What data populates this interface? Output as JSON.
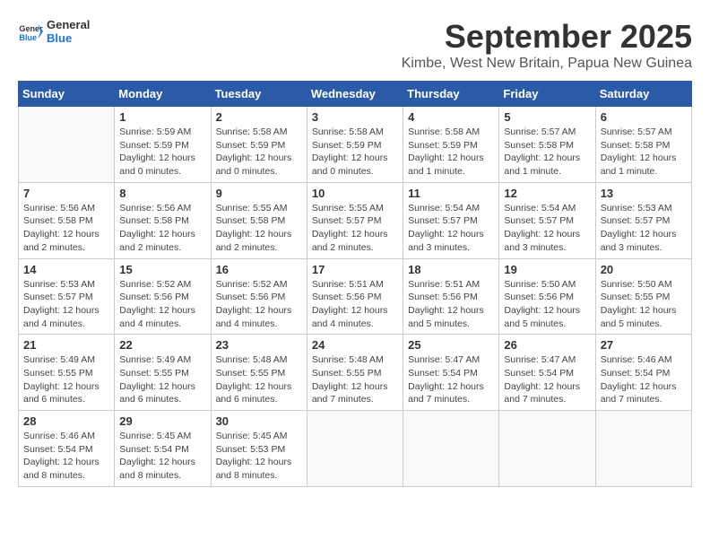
{
  "logo": {
    "general": "General",
    "blue": "Blue"
  },
  "title": "September 2025",
  "subtitle": "Kimbe, West New Britain, Papua New Guinea",
  "headers": [
    "Sunday",
    "Monday",
    "Tuesday",
    "Wednesday",
    "Thursday",
    "Friday",
    "Saturday"
  ],
  "weeks": [
    [
      {
        "day": "",
        "info": ""
      },
      {
        "day": "1",
        "info": "Sunrise: 5:59 AM\nSunset: 5:59 PM\nDaylight: 12 hours\nand 0 minutes."
      },
      {
        "day": "2",
        "info": "Sunrise: 5:58 AM\nSunset: 5:59 PM\nDaylight: 12 hours\nand 0 minutes."
      },
      {
        "day": "3",
        "info": "Sunrise: 5:58 AM\nSunset: 5:59 PM\nDaylight: 12 hours\nand 0 minutes."
      },
      {
        "day": "4",
        "info": "Sunrise: 5:58 AM\nSunset: 5:59 PM\nDaylight: 12 hours\nand 1 minute."
      },
      {
        "day": "5",
        "info": "Sunrise: 5:57 AM\nSunset: 5:58 PM\nDaylight: 12 hours\nand 1 minute."
      },
      {
        "day": "6",
        "info": "Sunrise: 5:57 AM\nSunset: 5:58 PM\nDaylight: 12 hours\nand 1 minute."
      }
    ],
    [
      {
        "day": "7",
        "info": "Sunrise: 5:56 AM\nSunset: 5:58 PM\nDaylight: 12 hours\nand 2 minutes."
      },
      {
        "day": "8",
        "info": "Sunrise: 5:56 AM\nSunset: 5:58 PM\nDaylight: 12 hours\nand 2 minutes."
      },
      {
        "day": "9",
        "info": "Sunrise: 5:55 AM\nSunset: 5:58 PM\nDaylight: 12 hours\nand 2 minutes."
      },
      {
        "day": "10",
        "info": "Sunrise: 5:55 AM\nSunset: 5:57 PM\nDaylight: 12 hours\nand 2 minutes."
      },
      {
        "day": "11",
        "info": "Sunrise: 5:54 AM\nSunset: 5:57 PM\nDaylight: 12 hours\nand 3 minutes."
      },
      {
        "day": "12",
        "info": "Sunrise: 5:54 AM\nSunset: 5:57 PM\nDaylight: 12 hours\nand 3 minutes."
      },
      {
        "day": "13",
        "info": "Sunrise: 5:53 AM\nSunset: 5:57 PM\nDaylight: 12 hours\nand 3 minutes."
      }
    ],
    [
      {
        "day": "14",
        "info": "Sunrise: 5:53 AM\nSunset: 5:57 PM\nDaylight: 12 hours\nand 4 minutes."
      },
      {
        "day": "15",
        "info": "Sunrise: 5:52 AM\nSunset: 5:56 PM\nDaylight: 12 hours\nand 4 minutes."
      },
      {
        "day": "16",
        "info": "Sunrise: 5:52 AM\nSunset: 5:56 PM\nDaylight: 12 hours\nand 4 minutes."
      },
      {
        "day": "17",
        "info": "Sunrise: 5:51 AM\nSunset: 5:56 PM\nDaylight: 12 hours\nand 4 minutes."
      },
      {
        "day": "18",
        "info": "Sunrise: 5:51 AM\nSunset: 5:56 PM\nDaylight: 12 hours\nand 5 minutes."
      },
      {
        "day": "19",
        "info": "Sunrise: 5:50 AM\nSunset: 5:56 PM\nDaylight: 12 hours\nand 5 minutes."
      },
      {
        "day": "20",
        "info": "Sunrise: 5:50 AM\nSunset: 5:55 PM\nDaylight: 12 hours\nand 5 minutes."
      }
    ],
    [
      {
        "day": "21",
        "info": "Sunrise: 5:49 AM\nSunset: 5:55 PM\nDaylight: 12 hours\nand 6 minutes."
      },
      {
        "day": "22",
        "info": "Sunrise: 5:49 AM\nSunset: 5:55 PM\nDaylight: 12 hours\nand 6 minutes."
      },
      {
        "day": "23",
        "info": "Sunrise: 5:48 AM\nSunset: 5:55 PM\nDaylight: 12 hours\nand 6 minutes."
      },
      {
        "day": "24",
        "info": "Sunrise: 5:48 AM\nSunset: 5:55 PM\nDaylight: 12 hours\nand 7 minutes."
      },
      {
        "day": "25",
        "info": "Sunrise: 5:47 AM\nSunset: 5:54 PM\nDaylight: 12 hours\nand 7 minutes."
      },
      {
        "day": "26",
        "info": "Sunrise: 5:47 AM\nSunset: 5:54 PM\nDaylight: 12 hours\nand 7 minutes."
      },
      {
        "day": "27",
        "info": "Sunrise: 5:46 AM\nSunset: 5:54 PM\nDaylight: 12 hours\nand 7 minutes."
      }
    ],
    [
      {
        "day": "28",
        "info": "Sunrise: 5:46 AM\nSunset: 5:54 PM\nDaylight: 12 hours\nand 8 minutes."
      },
      {
        "day": "29",
        "info": "Sunrise: 5:45 AM\nSunset: 5:54 PM\nDaylight: 12 hours\nand 8 minutes."
      },
      {
        "day": "30",
        "info": "Sunrise: 5:45 AM\nSunset: 5:53 PM\nDaylight: 12 hours\nand 8 minutes."
      },
      {
        "day": "",
        "info": ""
      },
      {
        "day": "",
        "info": ""
      },
      {
        "day": "",
        "info": ""
      },
      {
        "day": "",
        "info": ""
      }
    ]
  ]
}
